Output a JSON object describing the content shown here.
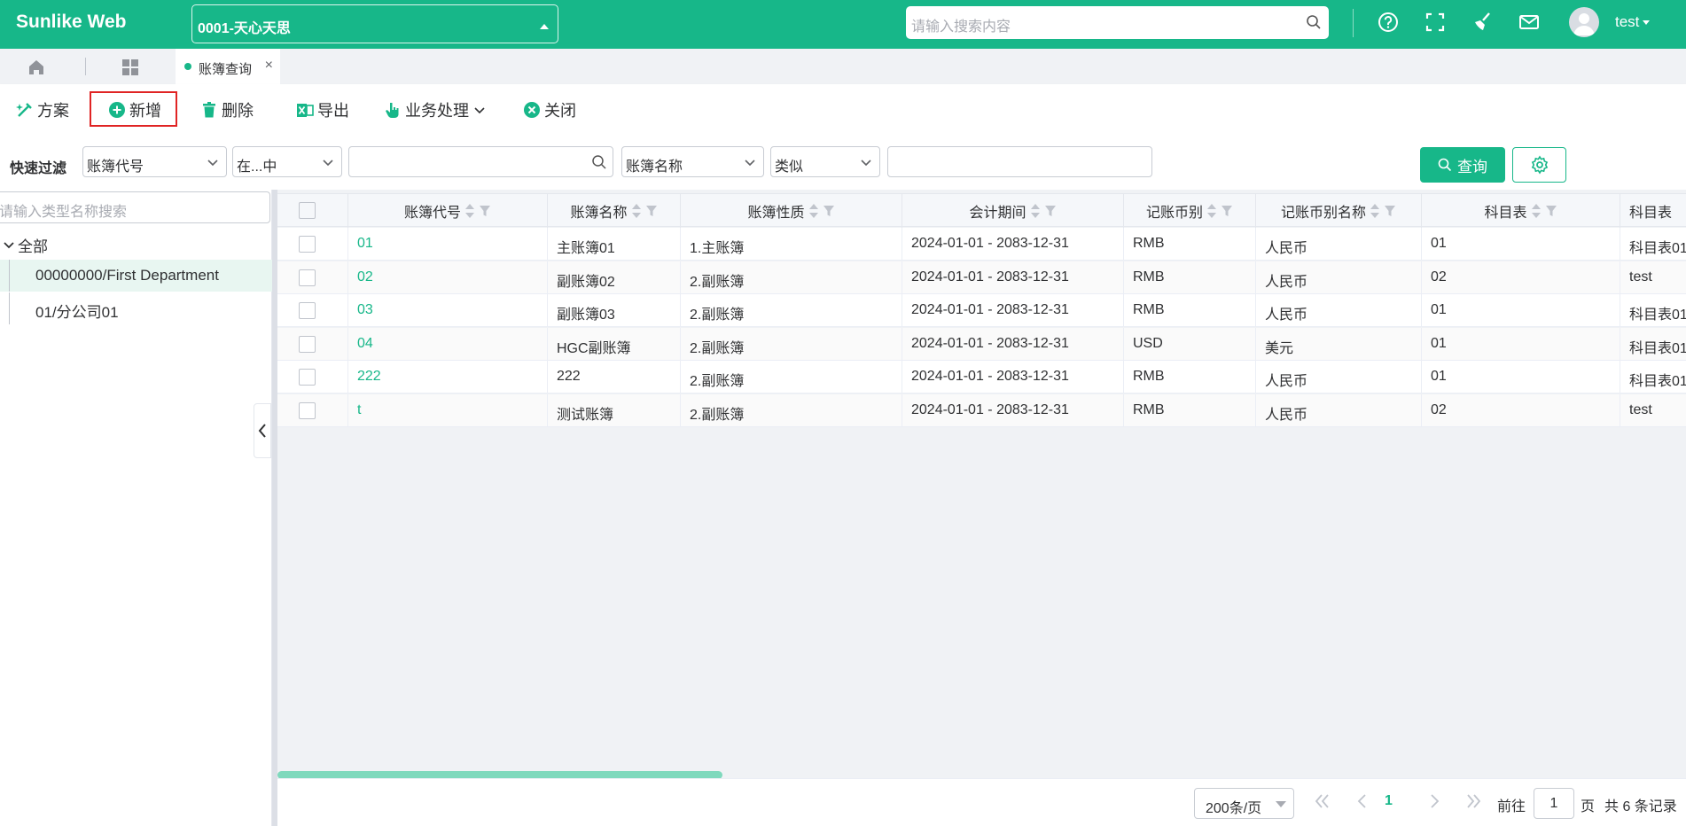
{
  "app": {
    "brand": "Sunlike Web",
    "company": "0001-天心天思",
    "search_placeholder": "请输入搜索内容",
    "user_name": "test",
    "accent_color": "#17b789"
  },
  "tabs": [
    {
      "label": "账簿查询",
      "active": true
    }
  ],
  "toolbar": {
    "scheme": "方案",
    "new": "新增",
    "delete": "删除",
    "export": "导出",
    "business": "业务处理",
    "close": "关闭"
  },
  "filter": {
    "label": "快速过滤",
    "field1": "账簿代号",
    "op1": "在...中",
    "value1": "",
    "field2": "账簿名称",
    "op2": "类似",
    "value2": "",
    "query_button": "查询"
  },
  "tree": {
    "search_placeholder": "请输入类型名称搜索",
    "root": "全部",
    "nodes": [
      "00000000/First Department",
      "01/分公司01"
    ]
  },
  "table": {
    "columns": [
      "账簿代号",
      "账簿名称",
      "账簿性质",
      "会计期间",
      "记账币别",
      "记账币别名称",
      "科目表",
      "科目表"
    ],
    "rows": [
      [
        "01",
        "主账簿01",
        "1.主账簿",
        "2024-01-01 - 2083-12-31",
        "RMB",
        "人民币",
        "01",
        "科目表01"
      ],
      [
        "02",
        "副账簿02",
        "2.副账簿",
        "2024-01-01 - 2083-12-31",
        "RMB",
        "人民币",
        "02",
        "test"
      ],
      [
        "03",
        "副账簿03",
        "2.副账簿",
        "2024-01-01 - 2083-12-31",
        "RMB",
        "人民币",
        "01",
        "科目表01"
      ],
      [
        "04",
        "HGC副账簿",
        "2.副账簿",
        "2024-01-01 - 2083-12-31",
        "USD",
        "美元",
        "01",
        "科目表01"
      ],
      [
        "222",
        "222",
        "2.副账簿",
        "2024-01-01 - 2083-12-31",
        "RMB",
        "人民币",
        "01",
        "科目表01"
      ],
      [
        "t",
        "测试账簿",
        "2.副账簿",
        "2024-01-01 - 2083-12-31",
        "RMB",
        "人民币",
        "02",
        "test"
      ]
    ]
  },
  "pager": {
    "page_size": "200条/页",
    "current_page": "1",
    "goto_label": "前往",
    "goto_value": "1",
    "page_unit": "页",
    "total": "共 6 条记录"
  }
}
